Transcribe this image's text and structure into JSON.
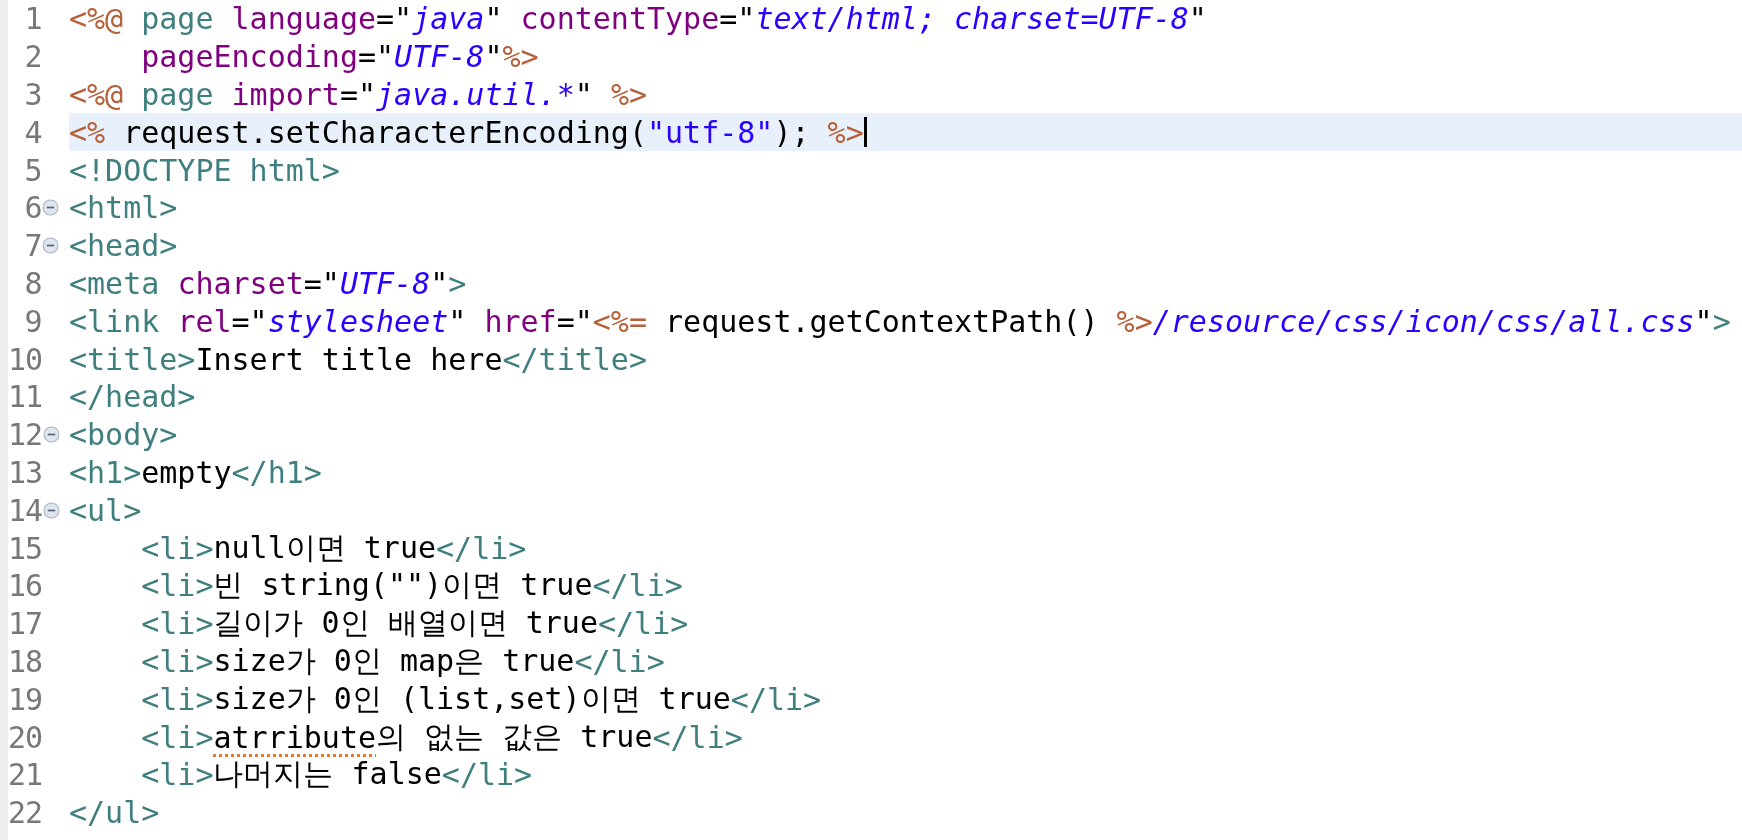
{
  "editor": {
    "lines": [
      {
        "number": "1",
        "current": false,
        "indented": false,
        "tokens": [
          {
            "kind": "delim",
            "text": "<%@"
          },
          {
            "kind": "tag",
            "text": " page "
          },
          {
            "kind": "attr",
            "text": "language"
          },
          {
            "kind": "plain",
            "text": "=\""
          },
          {
            "kind": "value",
            "text": "java"
          },
          {
            "kind": "plain",
            "text": "\" "
          },
          {
            "kind": "attr",
            "text": "contentType"
          },
          {
            "kind": "plain",
            "text": "=\""
          },
          {
            "kind": "value",
            "text": "text/html; charset=UTF-8"
          },
          {
            "kind": "plain",
            "text": "\""
          }
        ]
      },
      {
        "number": "2",
        "current": false,
        "indented": true,
        "tokens": [
          {
            "kind": "attr",
            "text": "pageEncoding"
          },
          {
            "kind": "plain",
            "text": "=\""
          },
          {
            "kind": "value",
            "text": "UTF-8"
          },
          {
            "kind": "plain",
            "text": "\""
          },
          {
            "kind": "delim",
            "text": "%>"
          }
        ]
      },
      {
        "number": "3",
        "current": false,
        "indented": false,
        "tokens": [
          {
            "kind": "delim",
            "text": "<%@"
          },
          {
            "kind": "tag",
            "text": " page "
          },
          {
            "kind": "attr",
            "text": "import"
          },
          {
            "kind": "plain",
            "text": "=\""
          },
          {
            "kind": "value",
            "text": "java.util.*"
          },
          {
            "kind": "plain",
            "text": "\" "
          },
          {
            "kind": "delim",
            "text": "%>"
          }
        ]
      },
      {
        "number": "4",
        "current": true,
        "indented": false,
        "tokens": [
          {
            "kind": "delim",
            "text": "<%"
          },
          {
            "kind": "plain",
            "text": " request.setCharacterEncoding("
          },
          {
            "kind": "string",
            "text": "\"utf-8\""
          },
          {
            "kind": "plain",
            "text": "); "
          },
          {
            "kind": "delim",
            "text": "%>"
          }
        ]
      },
      {
        "number": "5",
        "current": false,
        "indented": false,
        "tokens": [
          {
            "kind": "tag",
            "text": "<!DOCTYPE html>"
          }
        ]
      },
      {
        "number": "6",
        "current": false,
        "indented": false,
        "fold": {
          "expanded": true
        },
        "tokens": [
          {
            "kind": "tag",
            "text": "<html>"
          }
        ]
      },
      {
        "number": "7",
        "current": false,
        "indented": false,
        "fold": {
          "expanded": true
        },
        "tokens": [
          {
            "kind": "tag",
            "text": "<head>"
          }
        ]
      },
      {
        "number": "8",
        "current": false,
        "indented": false,
        "tokens": [
          {
            "kind": "tag",
            "text": "<meta "
          },
          {
            "kind": "attr",
            "text": "charset"
          },
          {
            "kind": "plain",
            "text": "=\""
          },
          {
            "kind": "value",
            "text": "UTF-8"
          },
          {
            "kind": "plain",
            "text": "\""
          },
          {
            "kind": "tag",
            "text": ">"
          }
        ]
      },
      {
        "number": "9",
        "current": false,
        "indented": false,
        "tokens": [
          {
            "kind": "tag",
            "text": "<link "
          },
          {
            "kind": "attr",
            "text": "rel"
          },
          {
            "kind": "plain",
            "text": "=\""
          },
          {
            "kind": "value",
            "text": "stylesheet"
          },
          {
            "kind": "plain",
            "text": "\" "
          },
          {
            "kind": "attr",
            "text": "href"
          },
          {
            "kind": "plain",
            "text": "=\""
          },
          {
            "kind": "delim",
            "text": "<%="
          },
          {
            "kind": "plain",
            "text": " request.getContextPath() "
          },
          {
            "kind": "delim",
            "text": "%>"
          },
          {
            "kind": "value",
            "text": "/resource/css/icon/css/all.css"
          },
          {
            "kind": "plain",
            "text": "\""
          },
          {
            "kind": "tag",
            "text": ">"
          }
        ]
      },
      {
        "number": "10",
        "current": false,
        "indented": false,
        "tokens": [
          {
            "kind": "tag",
            "text": "<title>"
          },
          {
            "kind": "plain",
            "text": "Insert title here"
          },
          {
            "kind": "tag",
            "text": "</title>"
          }
        ]
      },
      {
        "number": "11",
        "current": false,
        "indented": false,
        "tokens": [
          {
            "kind": "tag",
            "text": "</head>"
          }
        ]
      },
      {
        "number": "12",
        "current": false,
        "indented": false,
        "fold": {
          "expanded": true
        },
        "tokens": [
          {
            "kind": "tag",
            "text": "<body>"
          }
        ]
      },
      {
        "number": "13",
        "current": false,
        "indented": false,
        "tokens": [
          {
            "kind": "tag",
            "text": "<h1>"
          },
          {
            "kind": "plain",
            "text": "empty"
          },
          {
            "kind": "tag",
            "text": "</h1>"
          }
        ]
      },
      {
        "number": "14",
        "current": false,
        "indented": false,
        "fold": {
          "expanded": true
        },
        "tokens": [
          {
            "kind": "tag",
            "text": "<ul>"
          }
        ]
      },
      {
        "number": "15",
        "current": false,
        "indented": true,
        "tokens": [
          {
            "kind": "tag",
            "text": "<li>"
          },
          {
            "kind": "plain",
            "text": "null이면 true"
          },
          {
            "kind": "tag",
            "text": "</li>"
          }
        ]
      },
      {
        "number": "16",
        "current": false,
        "indented": true,
        "tokens": [
          {
            "kind": "tag",
            "text": "<li>"
          },
          {
            "kind": "plain",
            "text": "빈 string(\"\")이면 true"
          },
          {
            "kind": "tag",
            "text": "</li>"
          }
        ]
      },
      {
        "number": "17",
        "current": false,
        "indented": true,
        "tokens": [
          {
            "kind": "tag",
            "text": "<li>"
          },
          {
            "kind": "plain",
            "text": "길이가 0인 배열이면 true"
          },
          {
            "kind": "tag",
            "text": "</li>"
          }
        ]
      },
      {
        "number": "18",
        "current": false,
        "indented": true,
        "tokens": [
          {
            "kind": "tag",
            "text": "<li>"
          },
          {
            "kind": "plain",
            "text": "size가 0인 map은 true"
          },
          {
            "kind": "tag",
            "text": "</li>"
          }
        ]
      },
      {
        "number": "19",
        "current": false,
        "indented": true,
        "tokens": [
          {
            "kind": "tag",
            "text": "<li>"
          },
          {
            "kind": "plain",
            "text": "size가 0인 (list,set)이면 true"
          },
          {
            "kind": "tag",
            "text": "</li>"
          }
        ]
      },
      {
        "number": "20",
        "current": false,
        "indented": true,
        "tokens": [
          {
            "kind": "tag",
            "text": "<li>"
          },
          {
            "kind": "plain",
            "text": "atrribute",
            "misspelled": true
          },
          {
            "kind": "plain",
            "text": "의 없는 값은 true"
          },
          {
            "kind": "tag",
            "text": "</li>"
          }
        ]
      },
      {
        "number": "21",
        "current": false,
        "indented": true,
        "tokens": [
          {
            "kind": "tag",
            "text": "<li>"
          },
          {
            "kind": "plain",
            "text": "나머지는 false"
          },
          {
            "kind": "tag",
            "text": "</li>"
          }
        ]
      },
      {
        "number": "22",
        "current": false,
        "indented": false,
        "tokens": [
          {
            "kind": "tag",
            "text": "</ul>"
          }
        ]
      }
    ]
  }
}
